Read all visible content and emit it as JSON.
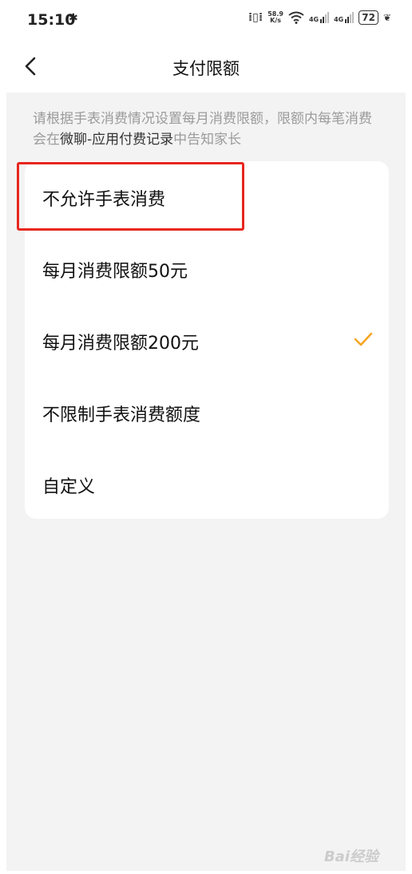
{
  "status_bar": {
    "time": "15:10",
    "network_speed_value": "58.9",
    "network_speed_unit": "K/s",
    "sim1_label": "4G",
    "sim2_label": "4G",
    "battery": "72"
  },
  "nav": {
    "title": "支付限额"
  },
  "hint": {
    "prefix": "请根据手表消费情况设置每月消费限额，限额内每笔消费会在",
    "emphasis": "微聊-应用付费记录",
    "suffix": "中告知家长"
  },
  "options": [
    {
      "label": "不允许手表消费",
      "selected": false
    },
    {
      "label": "每月消费限额50元",
      "selected": false
    },
    {
      "label": "每月消费限额200元",
      "selected": true
    },
    {
      "label": "不限制手表消费额度",
      "selected": false
    },
    {
      "label": "自定义",
      "selected": false
    }
  ],
  "colors": {
    "accent_check": "#f5a623",
    "highlight_box": "#e8261e",
    "page_background": "#f3f3f3"
  },
  "watermark": {
    "text": "Bai经验"
  }
}
